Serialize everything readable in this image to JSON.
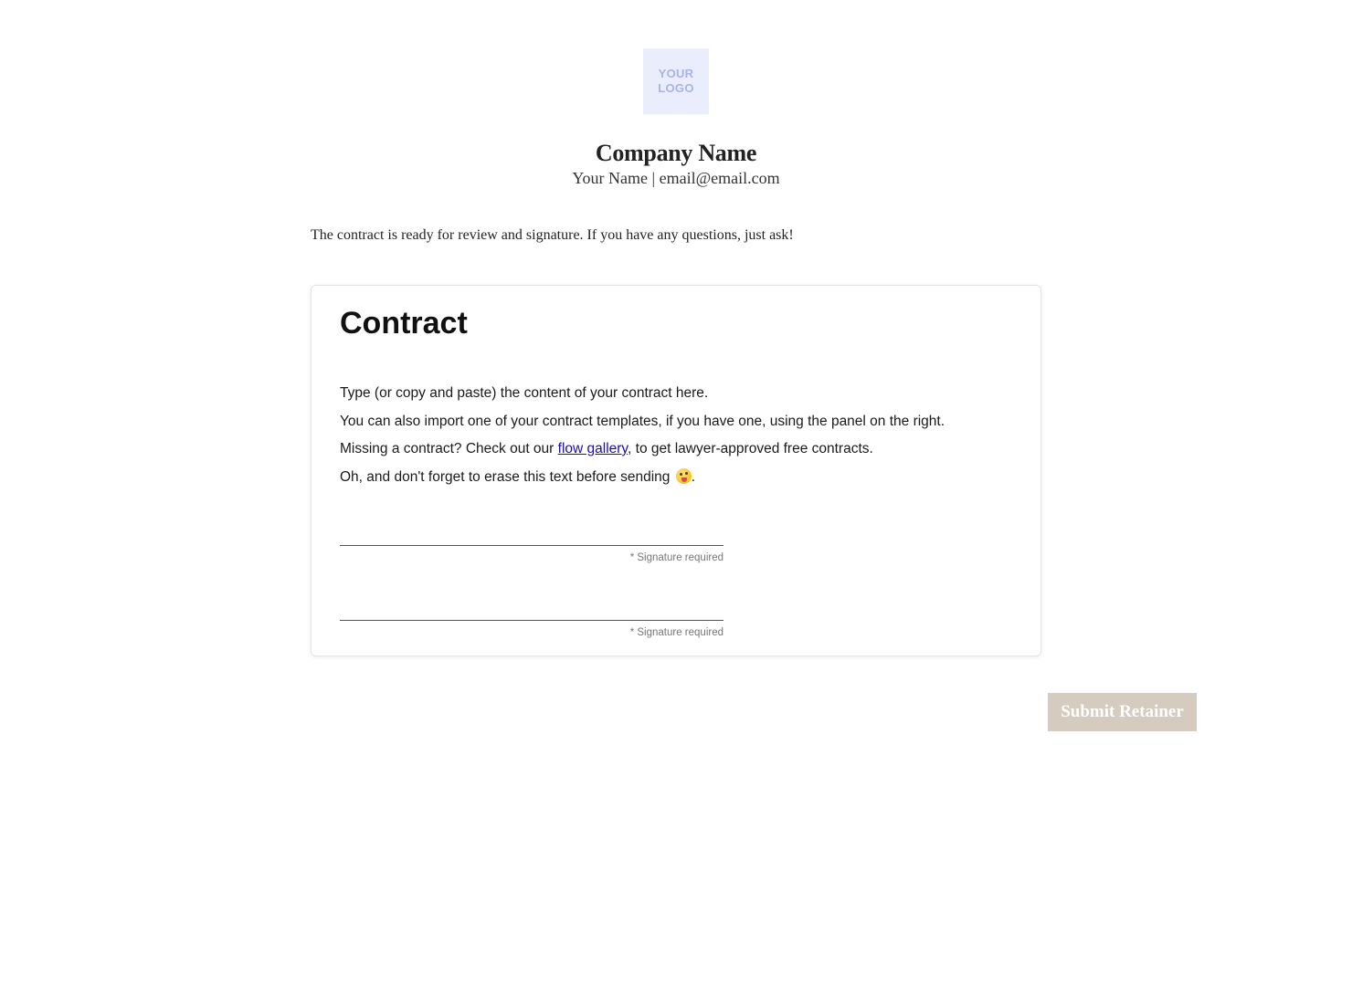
{
  "header": {
    "logo_line1": "YOUR",
    "logo_line2": "LOGO",
    "company_name": "Company Name",
    "contact_line": "Your Name | email@email.com"
  },
  "intro": {
    "text": "The contract is ready for review and signature. If you have any questions, just ask!"
  },
  "contract": {
    "title": "Contract",
    "line1": "Type (or copy and paste) the content of your contract here.",
    "line2": "You can also import one of your contract templates, if you have one, using the panel on the right.",
    "line3_before": "Missing a contract? Check out our ",
    "line3_link": "flow gallery",
    "line3_after": ", to get lawyer-approved free contracts.",
    "line4_before": "Oh, and don't forget to erase this text before sending ",
    "line4_icon": "winking-face-with-tongue-emoji",
    "line4_after": ".",
    "signatures": [
      {
        "required_note": "* Signature required"
      },
      {
        "required_note": "* Signature required"
      }
    ]
  },
  "actions": {
    "submit_label": "Submit Retainer",
    "submit_color": "#d6cbbf"
  },
  "colors": {
    "logo_bg": "#eaeefc",
    "logo_text": "#a9b3e6",
    "link": "#1a0dab"
  }
}
